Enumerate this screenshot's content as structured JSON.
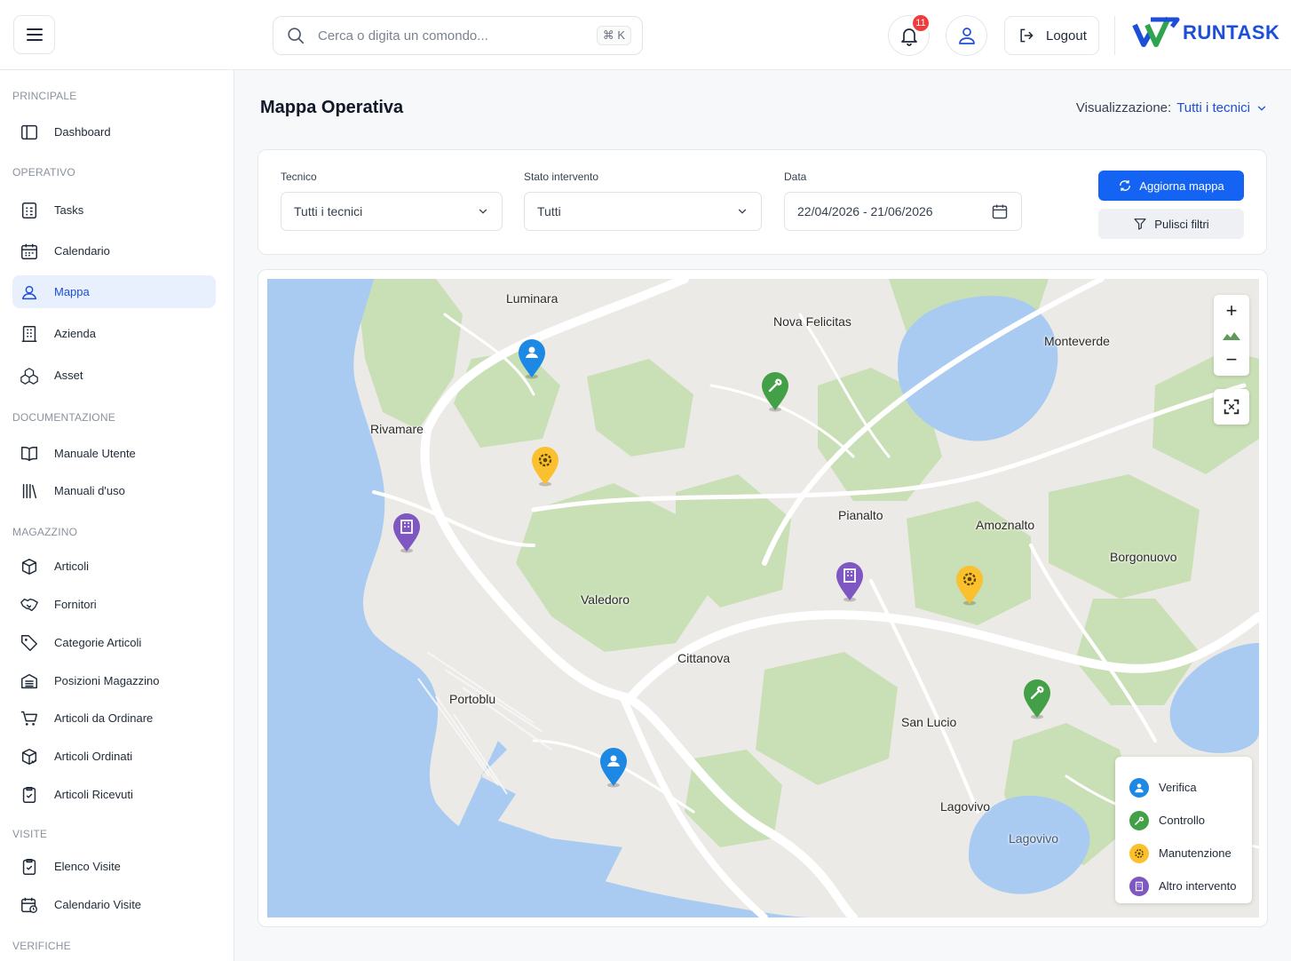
{
  "header": {
    "search_placeholder": "Cerca o digita un comondo...",
    "search_shortcut": "⌘ K",
    "notifications_count": "11",
    "logout_label": "Logout",
    "logo_text": "RUNTASK",
    "brand_color": "#1d4ed8"
  },
  "sidebar": {
    "sections": {
      "principale": "PRINCIPALE",
      "operativo": "OPERATIVO",
      "documentazione": "DOCUMENTAZIONE",
      "magazzino": "MAGAZZINO",
      "visite": "VISITE",
      "verifiche": "VERIFICHE"
    },
    "items": {
      "dashboard": "Dashboard",
      "tasks": "Tasks",
      "calendario": "Calendario",
      "mappa": "Mappa",
      "azienda": "Azienda",
      "asset": "Asset",
      "manuale_utente": "Manuale Utente",
      "manuali_uso": "Manuali d'uso",
      "articoli": "Articoli",
      "fornitori": "Fornitori",
      "categorie_articoli": "Categorie Articoli",
      "posizioni_magazzino": "Posizioni Magazzino",
      "articoli_da_ordinare": "Articoli da Ordinare",
      "articoli_ordinati": "Articoli Ordinati",
      "articoli_ricevuti": "Articoli Ricevuti",
      "elenco_visite": "Elenco Visite",
      "calendario_visite": "Calendario Visite"
    },
    "active_item": "Mappa"
  },
  "main": {
    "title": "Mappa Operativa",
    "view_label": "Visualizzazione:",
    "view_value": "Tutti i tecnici",
    "filters": {
      "tecnico_label": "Tecnico",
      "tecnico_value": "Tutti i tecnici",
      "stato_label": "Stato intervento",
      "stato_value": "Tutti",
      "data_label": "Data",
      "data_value": "22/04/2026 - 21/06/2026",
      "refresh_button": "Aggiorna mappa",
      "clear_button": "Pulisci filtri"
    }
  },
  "map": {
    "places": {
      "luminara": "Luminara",
      "nova_felicitas": "Nova Felicitas",
      "monteverde": "Monteverde",
      "rivamare": "Rivamare",
      "pianalto": "Pianalto",
      "amontalto": "Amoznalto",
      "borgonuovo": "Borgonuovo",
      "valedoro": "Valedoro",
      "cittanova": "Cittanova",
      "portoblu": "Portoblu",
      "san_lucio": "San Lucio",
      "lagovivo_town": "Lagovivo",
      "lagovivo_lake": "Lagovivo"
    },
    "zoom_in": "+",
    "zoom_out": "−",
    "legend": {
      "verifica": "Verifica",
      "controllo": "Controllo",
      "manutenzione": "Manutenzione",
      "altro": "Altro intervento"
    },
    "colors": {
      "verifica": "#1e88e5",
      "controllo": "#43a047",
      "manutenzione": "#fbc02d",
      "altro": "#7e57c2",
      "water": "#a9cbf2",
      "forest": "#c9dfb5",
      "land": "#eceae6"
    }
  }
}
